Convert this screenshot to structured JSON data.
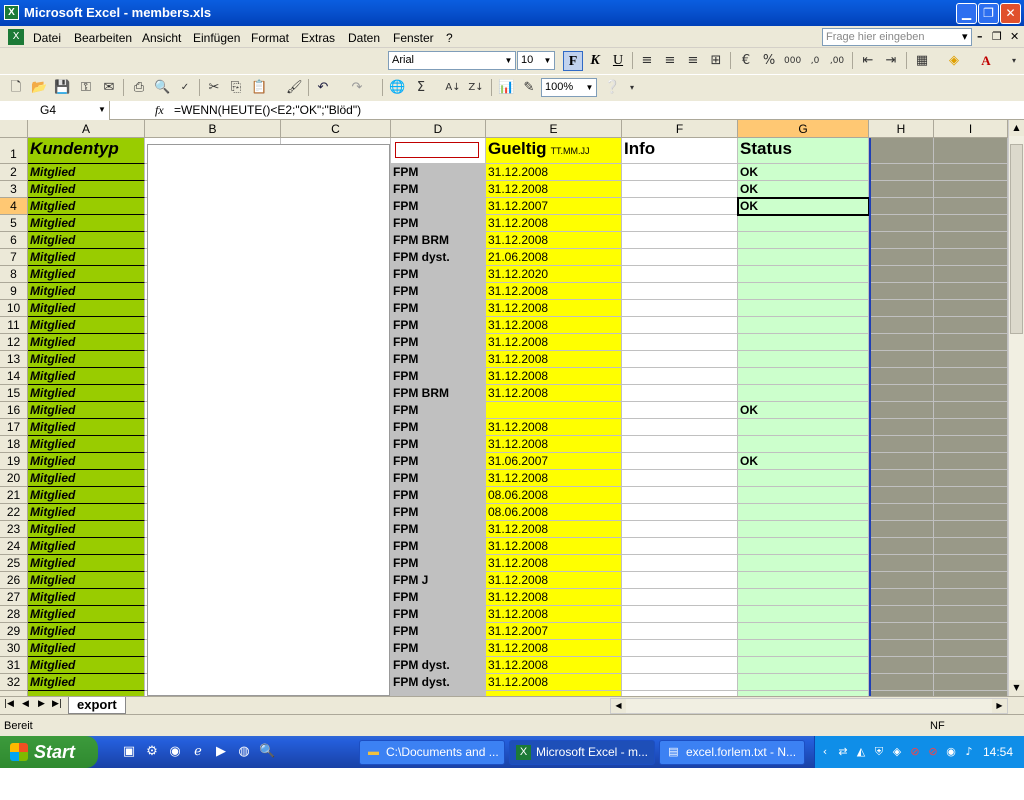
{
  "window": {
    "title": "Microsoft Excel - members.xls",
    "app_icon": "X"
  },
  "menu": {
    "items": [
      "Datei",
      "Bearbeiten",
      "Ansicht",
      "Einfügen",
      "Format",
      "Extras",
      "Daten",
      "Fenster",
      "?"
    ],
    "help_placeholder": "Frage hier eingeben"
  },
  "format_toolbar": {
    "font_name": "Arial",
    "font_size": "10",
    "bold": "F",
    "italic": "K",
    "underline": "U"
  },
  "standard_toolbar": {
    "zoom": "100%"
  },
  "formula_bar": {
    "cell_ref": "G4",
    "fx": "fx",
    "formula": "=WENN(HEUTE()<E2;\"OK\";\"Blöd\")"
  },
  "columns": [
    "A",
    "B",
    "C",
    "D",
    "E",
    "F",
    "G",
    "H",
    "I"
  ],
  "header_row": {
    "row": "1",
    "a": "Kundentyp",
    "e": "Gueltig",
    "e_small": "TT.MM.JJ",
    "f": "Info",
    "g": "Status"
  },
  "rows": [
    {
      "n": "2",
      "a": "Mitglied",
      "d": "FPM",
      "e": "31.12.2008",
      "g": "OK"
    },
    {
      "n": "3",
      "a": "Mitglied",
      "d": "FPM",
      "e": "31.12.2008",
      "g": "OK"
    },
    {
      "n": "4",
      "a": "Mitglied",
      "d": "FPM",
      "e": "31.12.2007",
      "g": "OK"
    },
    {
      "n": "5",
      "a": "Mitglied",
      "d": "FPM",
      "e": "31.12.2008",
      "g": ""
    },
    {
      "n": "6",
      "a": "Mitglied",
      "d": "FPM BRM",
      "e": "31.12.2008",
      "g": ""
    },
    {
      "n": "7",
      "a": "Mitglied",
      "d": "FPM dyst.",
      "e": "21.06.2008",
      "g": ""
    },
    {
      "n": "8",
      "a": "Mitglied",
      "d": "FPM",
      "e": "31.12.2020",
      "g": ""
    },
    {
      "n": "9",
      "a": "Mitglied",
      "d": "FPM",
      "e": "31.12.2008",
      "g": ""
    },
    {
      "n": "10",
      "a": "Mitglied",
      "d": "FPM",
      "e": "31.12.2008",
      "g": ""
    },
    {
      "n": "11",
      "a": "Mitglied",
      "d": "FPM",
      "e": "31.12.2008",
      "g": ""
    },
    {
      "n": "12",
      "a": "Mitglied",
      "d": "FPM",
      "e": "31.12.2008",
      "g": ""
    },
    {
      "n": "13",
      "a": "Mitglied",
      "d": "FPM",
      "e": "31.12.2008",
      "g": ""
    },
    {
      "n": "14",
      "a": "Mitglied",
      "d": "FPM",
      "e": "31.12.2008",
      "g": ""
    },
    {
      "n": "15",
      "a": "Mitglied",
      "d": "FPM BRM",
      "e": "31.12.2008",
      "g": ""
    },
    {
      "n": "16",
      "a": "Mitglied",
      "d": "FPM",
      "e": "",
      "g": "OK"
    },
    {
      "n": "17",
      "a": "Mitglied",
      "d": "FPM",
      "e": "31.12.2008",
      "g": ""
    },
    {
      "n": "18",
      "a": "Mitglied",
      "d": "FPM",
      "e": "31.12.2008",
      "g": ""
    },
    {
      "n": "19",
      "a": "Mitglied",
      "d": "FPM",
      "e": "31.06.2007",
      "g": "OK"
    },
    {
      "n": "20",
      "a": "Mitglied",
      "d": "FPM",
      "e": "31.12.2008",
      "g": ""
    },
    {
      "n": "21",
      "a": "Mitglied",
      "d": "FPM",
      "e": "08.06.2008",
      "g": ""
    },
    {
      "n": "22",
      "a": "Mitglied",
      "d": "FPM",
      "e": "08.06.2008",
      "g": ""
    },
    {
      "n": "23",
      "a": "Mitglied",
      "d": "FPM",
      "e": "31.12.2008",
      "g": ""
    },
    {
      "n": "24",
      "a": "Mitglied",
      "d": "FPM",
      "e": "31.12.2008",
      "g": ""
    },
    {
      "n": "25",
      "a": "Mitglied",
      "d": "FPM",
      "e": "31.12.2008",
      "g": ""
    },
    {
      "n": "26",
      "a": "Mitglied",
      "d": "FPM J",
      "e": "31.12.2008",
      "g": ""
    },
    {
      "n": "27",
      "a": "Mitglied",
      "d": "FPM",
      "e": "31.12.2008",
      "g": ""
    },
    {
      "n": "28",
      "a": "Mitglied",
      "d": "FPM",
      "e": "31.12.2008",
      "g": ""
    },
    {
      "n": "29",
      "a": "Mitglied",
      "d": "FPM",
      "e": "31.12.2007",
      "g": ""
    },
    {
      "n": "30",
      "a": "Mitglied",
      "d": "FPM",
      "e": "31.12.2008",
      "g": ""
    },
    {
      "n": "31",
      "a": "Mitglied",
      "d": "FPM dyst.",
      "e": "31.12.2008",
      "g": ""
    },
    {
      "n": "32",
      "a": "Mitglied",
      "d": "FPM dyst.",
      "e": "31.12.2008",
      "g": ""
    }
  ],
  "sheet_tab": "export",
  "status_bar": {
    "status": "Bereit",
    "mode": "NF"
  },
  "taskbar": {
    "start": "Start",
    "tasks": [
      {
        "label": "C:\\Documents and ...",
        "icon": "folder-icon"
      },
      {
        "label": "Microsoft Excel - m...",
        "icon": "excel-icon"
      },
      {
        "label": "excel.forlem.txt - N...",
        "icon": "notepad-icon"
      }
    ],
    "clock": "14:54"
  }
}
